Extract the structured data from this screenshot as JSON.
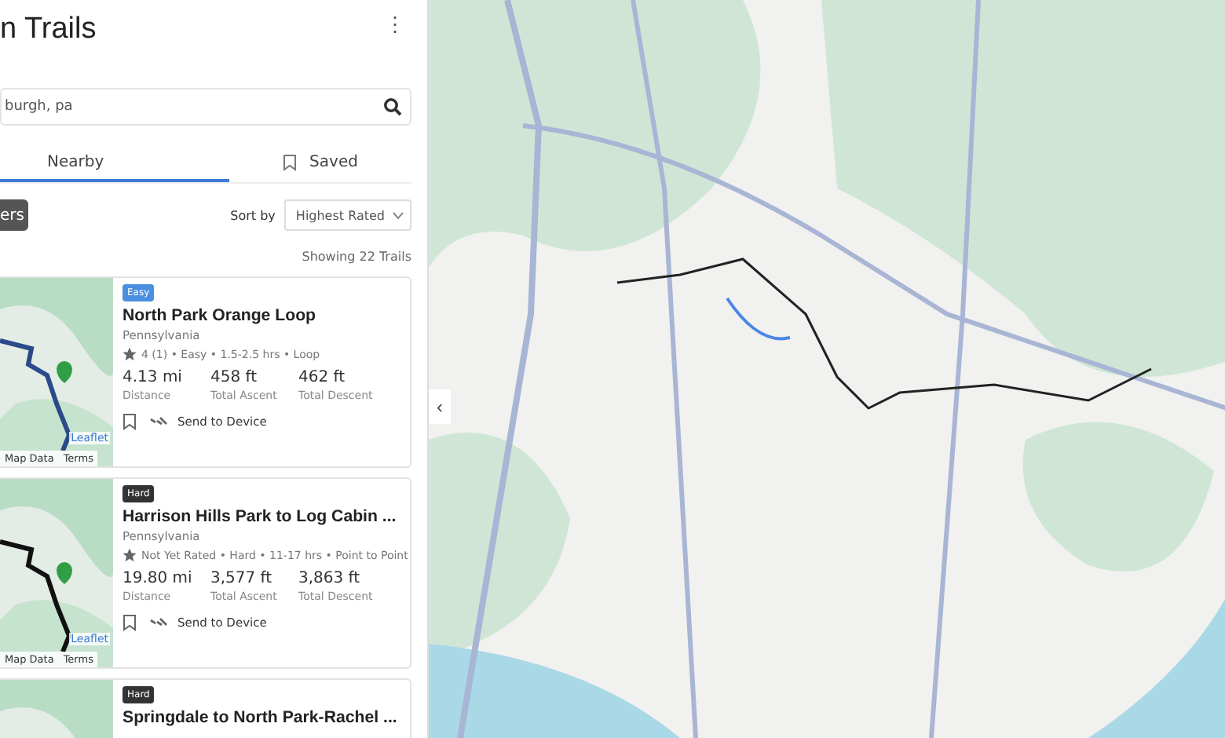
{
  "header": {
    "title": "n Trails",
    "menu": "⋮"
  },
  "search": {
    "value": "burgh, pa"
  },
  "tabs": [
    {
      "label": "Nearby",
      "selected": true,
      "icon": false
    },
    {
      "label": "Saved",
      "selected": false,
      "icon": true
    }
  ],
  "filters_button": "ers",
  "sort": {
    "label": "Sort by",
    "value": "Highest Rated"
  },
  "result_count": "Showing 22 Trails",
  "trails": [
    {
      "badge": "Easy",
      "kind": "easy",
      "name": "North Park Orange Loop",
      "region": "Pennsylvania",
      "meta": "4 (1) • Easy • 1.5-2.5 hrs • Loop",
      "stats": [
        {
          "value": "4.13 mi",
          "label": "Distance"
        },
        {
          "value": "458 ft",
          "label": "Total Ascent"
        },
        {
          "value": "462 ft",
          "label": "Total Descent"
        }
      ],
      "send": "Send to Device",
      "map_links": [
        "Leaflet",
        "Map Data",
        "Terms"
      ],
      "color": "#2a4a8a"
    },
    {
      "badge": "Hard",
      "kind": "hard",
      "name": "Harrison Hills Park to Log Cabin ...",
      "region": "Pennsylvania",
      "meta": "Not Yet Rated • Hard • 11-17 hrs • Point to Point",
      "stats": [
        {
          "value": "19.80 mi",
          "label": "Distance"
        },
        {
          "value": "3,577 ft",
          "label": "Total Ascent"
        },
        {
          "value": "3,863 ft",
          "label": "Total Descent"
        }
      ],
      "send": "Send to Device",
      "map_links": [
        "Leaflet",
        "Map Data",
        "Terms"
      ],
      "color": "#111111"
    },
    {
      "badge": "Hard",
      "kind": "hard",
      "name": "Springdale to North Park-Rachel ..."
    }
  ],
  "map": {
    "collapse": "‹"
  }
}
